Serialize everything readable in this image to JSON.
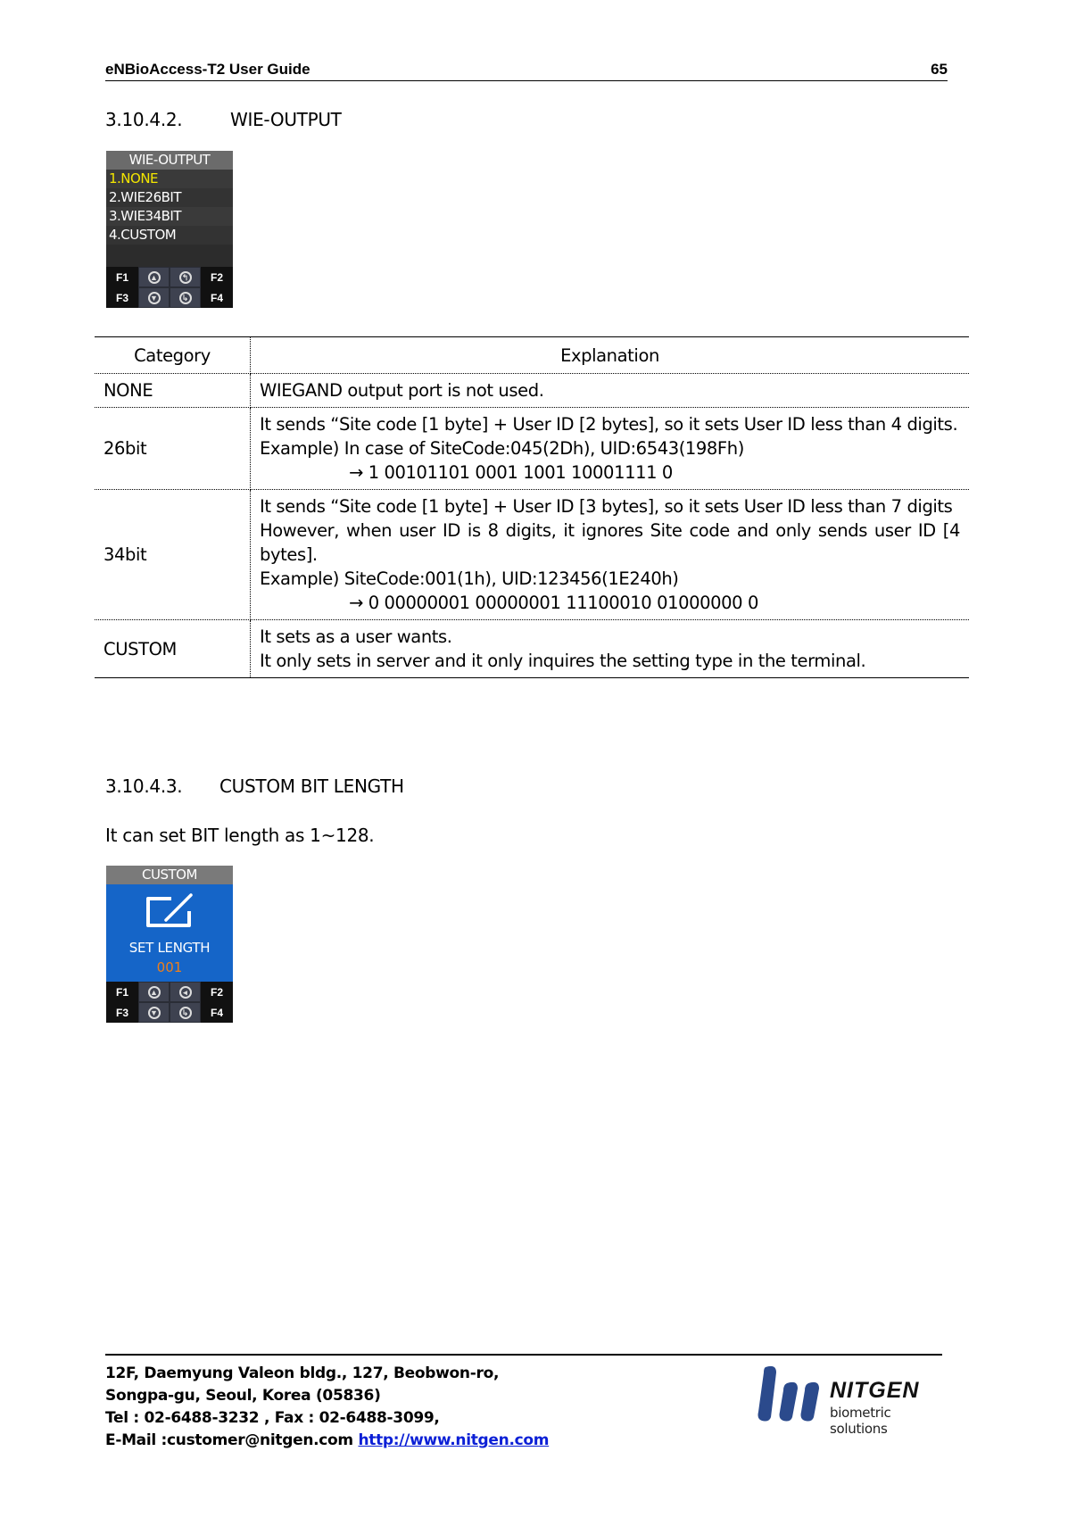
{
  "header": {
    "title": "eNBioAccess-T2 User Guide",
    "page_number": "65"
  },
  "section1": {
    "number": "3.10.4.2.",
    "title": "WIE-OUTPUT"
  },
  "screen1": {
    "title": "WIE-OUTPUT",
    "items": [
      "1.NONE",
      "2.WIE26BIT",
      "3.WIE34BIT",
      "4.CUSTOM"
    ],
    "selected_index": 0,
    "keys": {
      "f1": "F1",
      "f2": "F2",
      "f3": "F3",
      "f4": "F4"
    },
    "key_icons": [
      "arrow-up-icon",
      "back-icon",
      "arrow-down-icon",
      "enter-icon"
    ]
  },
  "table": {
    "headers": {
      "category": "Category",
      "explanation": "Explanation"
    },
    "rows": [
      {
        "category": "NONE",
        "lines": [
          "WIEGAND output port is not used."
        ]
      },
      {
        "category": "26bit",
        "lines": [
          "It sends “Site code [1 byte] + User ID [2 bytes], so it sets User ID less than 4 digits.",
          "Example) In case of SiteCode:045(2Dh), UID:6543(198Fh)",
          "→ 1 00101101 0001 1001 10001111 0"
        ]
      },
      {
        "category": "34bit",
        "lines": [
          "It sends “Site code [1 byte] + User ID [3 bytes], so it sets User ID less than 7 digits",
          "However, when user ID is 8 digits, it ignores Site code and only sends user ID [4 bytes].",
          "Example) SiteCode:001(1h), UID:123456(1E240h)",
          "→ 0 00000001 00000001 11100010 01000000 0"
        ]
      },
      {
        "category": "CUSTOM",
        "lines": [
          "It sets as a user wants.",
          "It only sets in server and it only inquires the setting type in the terminal."
        ]
      }
    ]
  },
  "section2": {
    "number": "3.10.4.3.",
    "title": "CUSTOM BIT LENGTH",
    "paragraph": "It can set BIT length as 1~128."
  },
  "screen2": {
    "title": "CUSTOM",
    "label": "SET LENGTH",
    "value": "001",
    "keys": {
      "f1": "F1",
      "f2": "F2",
      "f3": "F3",
      "f4": "F4"
    }
  },
  "footer": {
    "address_line1": "12F, Daemyung Valeon bldg., 127, Beobwon-ro,",
    "address_line2": "Songpa-gu, Seoul, Korea (05836)",
    "phone_line": "Tel : 02-6488-3232 , Fax : 02-6488-3099,",
    "email_prefix": "E-Mail :customer@nitgen.com ",
    "website": "http://www.nitgen.com"
  },
  "logo": {
    "brand": "NITGEN",
    "tagline": "biometric solutions",
    "color": "#2b4a8c"
  },
  "colors": {
    "selected_item": "#f3e600",
    "screen_blue": "#1565c8",
    "value_orange": "#ef7f1a",
    "link": "#0b1fd6"
  }
}
